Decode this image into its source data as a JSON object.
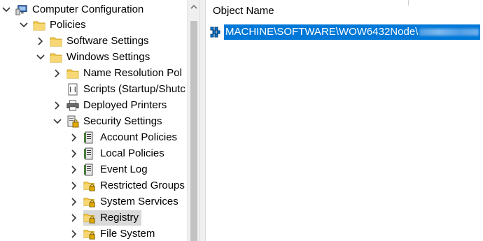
{
  "tree": {
    "computer_configuration": "Computer Configuration",
    "policies": "Policies",
    "software_settings": "Software Settings",
    "windows_settings": "Windows Settings",
    "name_resolution": "Name Resolution Pol",
    "scripts": "Scripts (Startup/Shutc",
    "deployed_printers": "Deployed Printers",
    "security_settings": "Security Settings",
    "account_policies": "Account Policies",
    "local_policies": "Local Policies",
    "event_log": "Event Log",
    "restricted_groups": "Restricted Groups",
    "system_services": "System Services",
    "registry": "Registry",
    "file_system": "File System"
  },
  "list": {
    "column_header": "Object Name",
    "item_text": "MACHINE\\SOFTWARE\\WOW6432Node\\"
  },
  "colors": {
    "selection_blue": "#0078d7",
    "tree_selection_gray": "#d9d9d9",
    "folder_yellow": "#f2c94c"
  }
}
